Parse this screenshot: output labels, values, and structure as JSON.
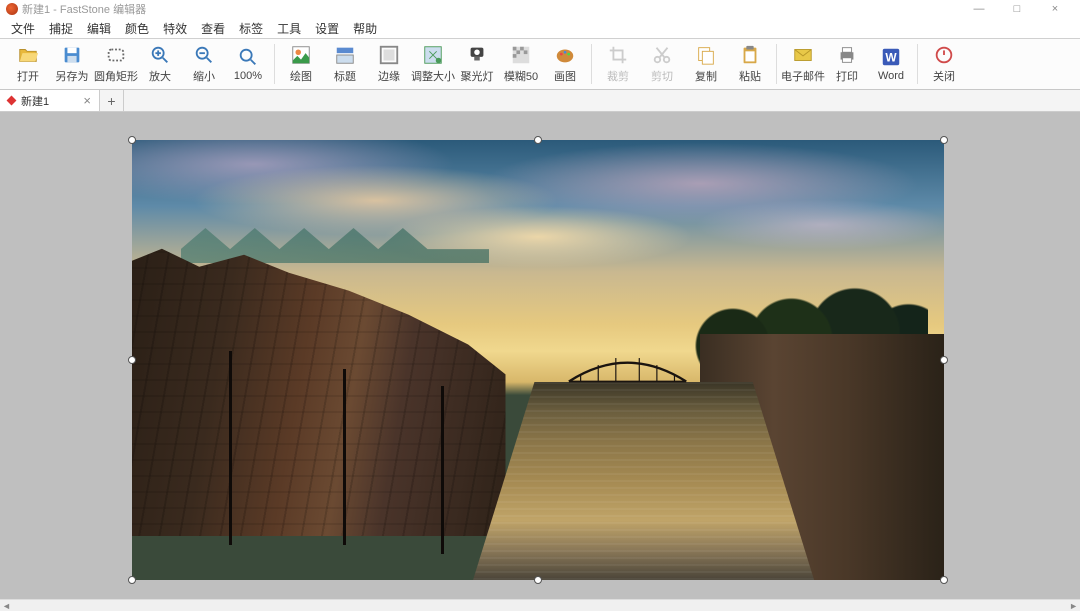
{
  "title": "新建1 - FastStone 编辑器",
  "window_controls": {
    "min": "—",
    "max": "□",
    "close": "×"
  },
  "menu": [
    "文件",
    "捕捉",
    "编辑",
    "颜色",
    "特效",
    "查看",
    "标签",
    "工具",
    "设置",
    "帮助"
  ],
  "toolbar": [
    {
      "label": "打开",
      "icon": "open-icon",
      "color": "#e8b83c"
    },
    {
      "label": "另存为",
      "icon": "save-icon",
      "color": "#4a8cd0"
    },
    {
      "label": "圆角矩形",
      "icon": "rounded-rect-icon",
      "color": "#666"
    },
    {
      "label": "放大",
      "icon": "zoom-in-icon",
      "color": "#3a78b8"
    },
    {
      "label": "缩小",
      "icon": "zoom-out-icon",
      "color": "#3a78b8"
    },
    {
      "label": "100%",
      "icon": "zoom-100-icon",
      "color": "#3a78b8"
    },
    {
      "sep": true
    },
    {
      "label": "绘图",
      "icon": "draw-icon",
      "color": "#3a9a4a"
    },
    {
      "label": "标题",
      "icon": "caption-icon",
      "color": "#5a8ad0"
    },
    {
      "label": "边缘",
      "icon": "edge-icon",
      "color": "#888"
    },
    {
      "label": "调整大小",
      "icon": "resize-icon",
      "color": "#4a9a5a"
    },
    {
      "label": "聚光灯",
      "icon": "spotlight-icon",
      "color": "#444"
    },
    {
      "label": "模糊50",
      "icon": "blur-icon",
      "color": "#888"
    },
    {
      "label": "画图",
      "icon": "paint-icon",
      "color": "#d08a3a"
    },
    {
      "sep": true
    },
    {
      "label": "裁剪",
      "icon": "crop-icon",
      "color": "#ccc",
      "disabled": true
    },
    {
      "label": "剪切",
      "icon": "cut-icon",
      "color": "#ccc",
      "disabled": true
    },
    {
      "label": "复制",
      "icon": "copy-icon",
      "color": "#d8a848"
    },
    {
      "label": "粘贴",
      "icon": "paste-icon",
      "color": "#d8a848"
    },
    {
      "sep": true
    },
    {
      "label": "电子邮件",
      "icon": "email-icon",
      "color": "#e8c848"
    },
    {
      "label": "打印",
      "icon": "print-icon",
      "color": "#888"
    },
    {
      "label": "Word",
      "icon": "word-icon",
      "color": "#3a5ab8"
    },
    {
      "sep": true
    },
    {
      "label": "关闭",
      "icon": "close-app-icon",
      "color": "#d04a4a"
    }
  ],
  "tabs": [
    {
      "label": "新建1",
      "dirty": true
    }
  ],
  "tab_add": "+"
}
